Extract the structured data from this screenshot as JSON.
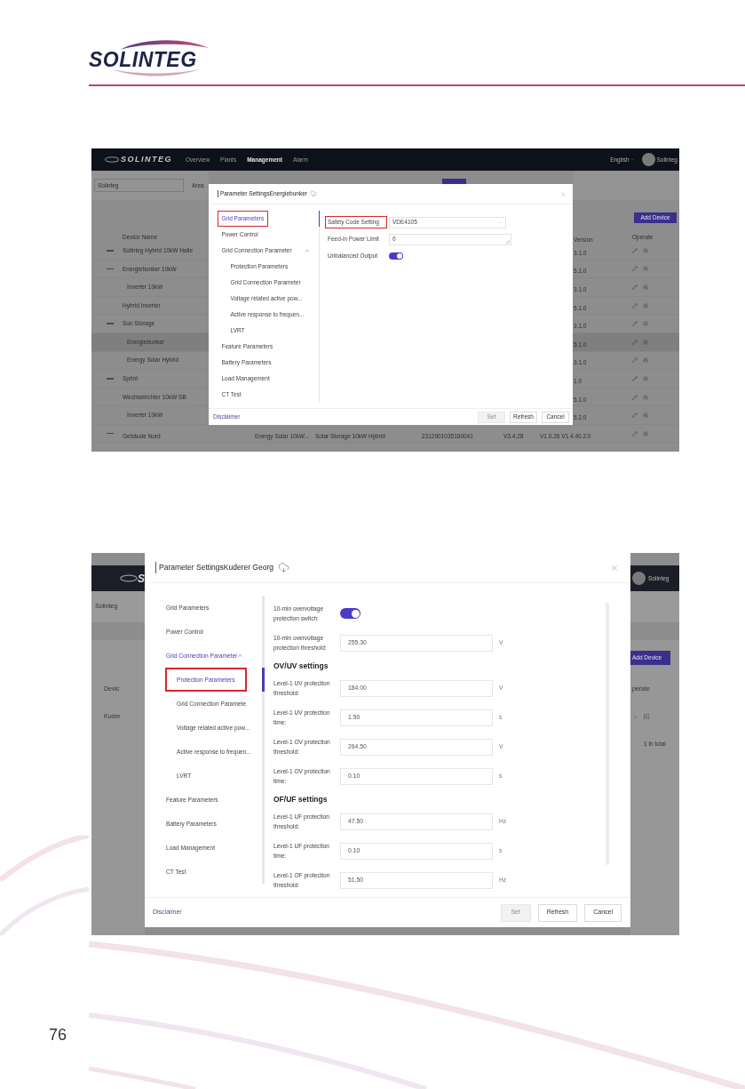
{
  "header": {
    "logo": "SOLINTEG"
  },
  "figure_top": {
    "navbar": {
      "logo": "SOLINTEG",
      "items": [
        {
          "label": "Overview",
          "selected": false
        },
        {
          "label": "Plants",
          "selected": false
        },
        {
          "label": "Management",
          "selected": true
        },
        {
          "label": "Alarm",
          "selected": false
        }
      ],
      "language": "English",
      "user": "Solinteg"
    },
    "filter": {
      "plant": "Solinteg",
      "area": "Area"
    },
    "add_button": "Add Device",
    "columns": {
      "name": "Device Name",
      "version": "Version",
      "operate": "Operate"
    },
    "rows": [
      {
        "name": "Solinteg Hybrid 10kW Halle",
        "firmware": "3.1.0",
        "expanded": true,
        "selected": false
      },
      {
        "name": "Energiebunker 10kW",
        "firmware": "5.1.0",
        "expanded": true,
        "selected": false,
        "children": [
          {
            "name": "Inverter 10kW",
            "firmware": "3.1.0",
            "selected": false
          }
        ]
      },
      {
        "name": "Hybrid Inverter",
        "firmware": "5.1.0",
        "expanded": false,
        "selected": false
      },
      {
        "name": "Sun Storage",
        "firmware": "3.1.0",
        "expanded": true,
        "selected": false,
        "children": [
          {
            "name": "Energiebunker",
            "firmware": "5.1.0",
            "selected": true
          },
          {
            "name": "Energy Solar Hybrid",
            "firmware": "3.1.0",
            "selected": false
          }
        ]
      },
      {
        "name": "Sprint",
        "firmware": "1.0",
        "expanded": true,
        "selected": false
      },
      {
        "name": "Wechselrichter 10kW SB",
        "firmware": "5.1.0",
        "selected": false,
        "children": [
          {
            "name": "Inverter 10kW",
            "firmware": "5.2.0",
            "selected": false
          }
        ]
      }
    ],
    "last_row": {
      "name": "Gebäude Nord",
      "model": "Energy Solar 10kW...",
      "type": "Solar Storage 10kW Hybrid",
      "serial_number": "2312901035160041",
      "version": "V3.4.28",
      "firmware": "V1.0.26 V1.4.40.2.0",
      "expanded": true,
      "selected": false
    },
    "dialog": {
      "title": "Parameter SettingsEnergiebunker",
      "menu": [
        {
          "label": "Grid Parameters",
          "selected": true,
          "annotated": true
        },
        {
          "label": "Power Control",
          "selected": false,
          "annotated": false
        },
        {
          "label": "Grid Connection Parameter",
          "selected": false,
          "annotated": false,
          "expanded": true,
          "children": [
            {
              "label": "Protection Parameters",
              "selected": false,
              "annotated": false
            },
            {
              "label": "Grid Connection Parameter",
              "selected": false,
              "annotated": false
            },
            {
              "label": "Voltage related active pow...",
              "selected": false,
              "annotated": false
            },
            {
              "label": "Active response to frequen...",
              "selected": false,
              "annotated": false
            },
            {
              "label": "LVRT",
              "selected": false,
              "annotated": false
            }
          ]
        },
        {
          "label": "Feature Parameters",
          "selected": false,
          "annotated": false
        },
        {
          "label": "Battery Parameters",
          "selected": false,
          "annotated": false
        },
        {
          "label": "Load Management",
          "selected": false,
          "annotated": false
        },
        {
          "label": "CT Test",
          "selected": false,
          "annotated": false
        }
      ],
      "fields": [
        {
          "kind": "select",
          "label": "Safety Code Setting",
          "value": "VDE4105",
          "annotated": true
        },
        {
          "kind": "input",
          "label": "Feed-in Power Limit",
          "value": "0",
          "annotated": false
        },
        {
          "kind": "switch",
          "label": "Unbalanced Output",
          "on": true,
          "annotated": false
        }
      ],
      "disclaimer": "Disclaimer",
      "buttons": [
        {
          "label": "Set",
          "disabled": true
        },
        {
          "label": "Refresh",
          "disabled": false
        },
        {
          "label": "Cancel",
          "disabled": false
        }
      ]
    }
  },
  "figure_bottom": {
    "navbar": {
      "logo": "S",
      "user": "Solinteg"
    },
    "filter": {
      "plant": "Solinteg"
    },
    "add_button": "Add Device",
    "columns": {
      "name": "Devic",
      "operate": "perate"
    },
    "rows": [
      {
        "name": "Kuder"
      }
    ],
    "total": "1 in total",
    "dialog": {
      "title": "Parameter SettingsKuderer Georg",
      "menu": [
        {
          "label": "Grid Parameters",
          "selected": false,
          "annotated": false
        },
        {
          "label": "Power Control",
          "selected": false,
          "annotated": false
        },
        {
          "label": "Grid Connection Parameter",
          "selected": true,
          "annotated": false,
          "expanded": true,
          "children": [
            {
              "label": "Protection Parameters",
              "selected": true,
              "annotated": true
            },
            {
              "label": "Grid Connection Paramete",
              "selected": false,
              "annotated": false
            },
            {
              "label": "Voltage related active pow...",
              "selected": false,
              "annotated": false
            },
            {
              "label": "Active response to frequen...",
              "selected": false,
              "annotated": false
            },
            {
              "label": "LVRT",
              "selected": false,
              "annotated": false
            }
          ]
        },
        {
          "label": "Feature Parameters",
          "selected": false,
          "annotated": false
        },
        {
          "label": "Battery Parameters",
          "selected": false,
          "annotated": false
        },
        {
          "label": "Load Management",
          "selected": false,
          "annotated": false
        },
        {
          "label": "CT Test",
          "selected": false,
          "annotated": false
        }
      ],
      "fields": [
        {
          "kind": "switch",
          "label": "10-min overvoltage protection switch:",
          "on": true
        },
        {
          "kind": "input",
          "label": "10-min overvoltage protection threshold:",
          "value": "255.30",
          "unit": "V"
        },
        {
          "kind": "heading",
          "label": "OV/UV settings"
        },
        {
          "kind": "input",
          "label": "Level-1 UV protection threshold:",
          "value": "184.00",
          "unit": "V"
        },
        {
          "kind": "input",
          "label": "Level-1 UV protection time:",
          "value": "1.50",
          "unit": "s"
        },
        {
          "kind": "input",
          "label": "Level-1 OV protection threshold:",
          "value": "264.50",
          "unit": "V"
        },
        {
          "kind": "input",
          "label": "Level-1 OV protection time:",
          "value": "0.10",
          "unit": "s"
        },
        {
          "kind": "heading",
          "label": "OF/UF settings"
        },
        {
          "kind": "input",
          "label": "Level-1 UF protection threshold:",
          "value": "47.50",
          "unit": "Hz"
        },
        {
          "kind": "input",
          "label": "Level-1 UF protection time:",
          "value": "0.10",
          "unit": "s"
        },
        {
          "kind": "input",
          "label": "Level-1 OF protection threshold:",
          "value": "51.50",
          "unit": "Hz"
        }
      ],
      "disclaimer": "Disclaimer",
      "buttons": [
        {
          "label": "Set",
          "disabled": true
        },
        {
          "label": "Refresh",
          "disabled": false
        },
        {
          "label": "Cancel",
          "disabled": false
        }
      ]
    }
  },
  "page_number": "76"
}
